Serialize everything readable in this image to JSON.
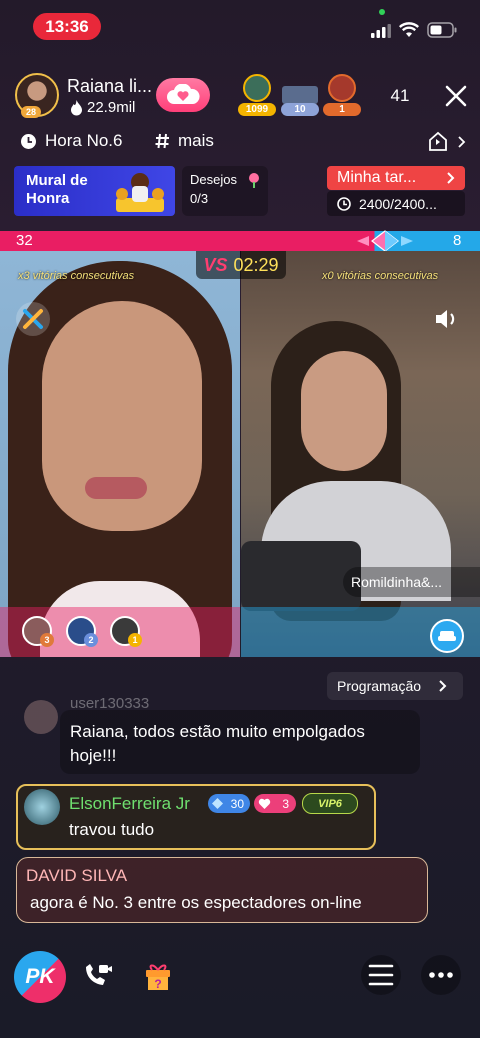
{
  "status_bar": {
    "time": "13:36"
  },
  "host": {
    "name": "Raiana li...",
    "fans": "22.9mil",
    "level": "28"
  },
  "top_ranks": [
    {
      "value": "1099",
      "color": "#f4b400"
    },
    {
      "value": "10",
      "color": "#8ea3d8"
    },
    {
      "value": "1",
      "color": "#e26a2c"
    }
  ],
  "viewer_count": "41",
  "tags": {
    "hour": "Hora No.6",
    "more": "mais"
  },
  "mural": {
    "title": "Mural de Honra"
  },
  "wishes": {
    "label": "Desejos",
    "value": "0/3"
  },
  "task": {
    "label": "Minha tar...",
    "progress": "2400/2400..."
  },
  "pk": {
    "left_score": "32",
    "right_score": "8",
    "timer": "02:29",
    "vs": "VS",
    "left_streak": "x3 vitórias consecutivas",
    "right_streak": "x0 vitórias consecutivas",
    "guest_name": "Romildinha&...",
    "left_supporters": [
      "3",
      "2",
      "1"
    ],
    "colors": {
      "left": "#e91e63",
      "right": "#24a8e8"
    }
  },
  "program_button": "Programação",
  "chat": [
    {
      "user": "user130333",
      "text": "Raiana, todos estão muito empolgados hoje!!!"
    },
    {
      "user_first": "Elson",
      "user_last": "Ferreira Jr",
      "level": "30",
      "fan_level": "3",
      "vip": "VIP6",
      "text": "travou tudo"
    },
    {
      "user": "DAVID SILVA",
      "text": "agora é No. 3 entre os espectadores on-line"
    }
  ],
  "bottom": {
    "pk_label": "PK"
  }
}
